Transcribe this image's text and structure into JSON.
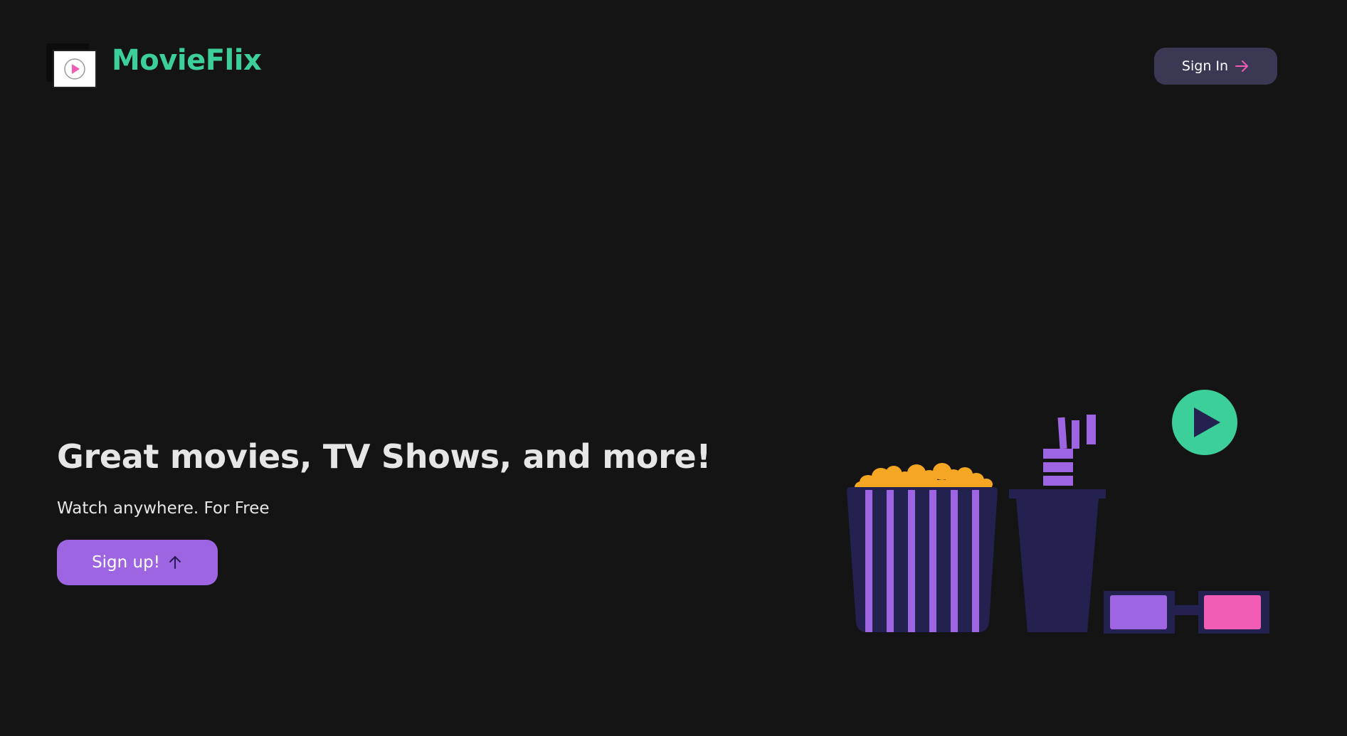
{
  "header": {
    "brand_name": "MovieFlix",
    "logo_icon": "play-circle-icon",
    "signin_label": "Sign In",
    "signin_icon": "arrow-right-icon"
  },
  "hero": {
    "title": "Great movies, TV Shows, and more!",
    "subtitle": "Watch anywhere. For Free",
    "signup_label": "Sign up!",
    "signup_icon": "arrow-up-icon"
  },
  "illustration": {
    "items": [
      "popcorn-bucket",
      "soda-cup",
      "3d-glasses",
      "play-button"
    ]
  },
  "colors": {
    "background": "#141414",
    "brand": "#3ccf99",
    "accent_purple": "#9d65e1",
    "accent_pink": "#f25cb5",
    "navy": "#23214f",
    "popcorn": "#f5a623",
    "signin_bg": "#3b3853"
  }
}
